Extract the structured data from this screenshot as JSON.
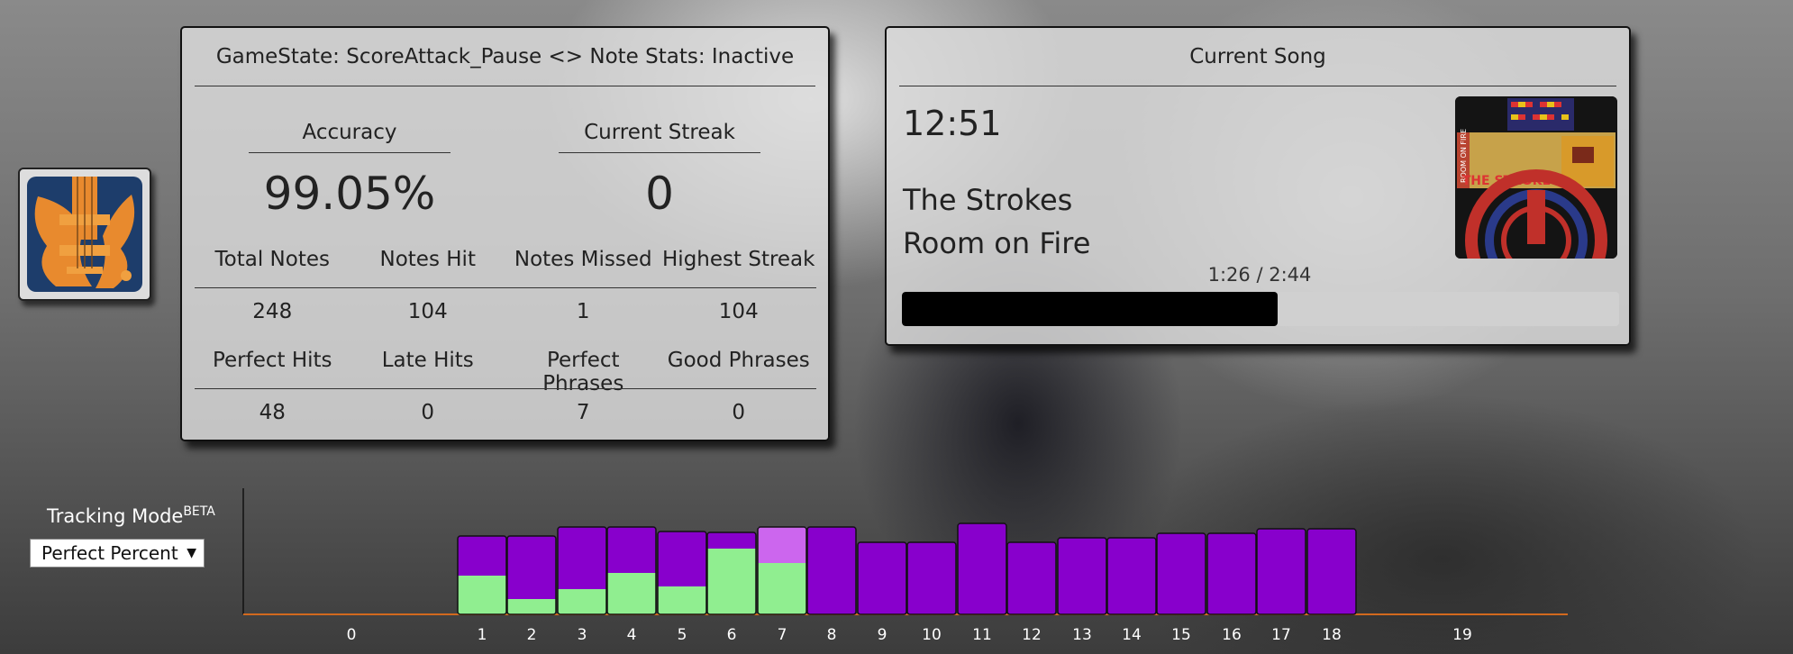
{
  "stats": {
    "title": "GameState: ScoreAttack_Pause <> Note Stats: Inactive",
    "accuracy_label": "Accuracy",
    "accuracy_value": "99.05%",
    "streak_label": "Current Streak",
    "streak_value": "0",
    "row1_headers": [
      "Total Notes",
      "Notes Hit",
      "Notes Missed",
      "Highest Streak"
    ],
    "row1_values": [
      "248",
      "104",
      "1",
      "104"
    ],
    "row2_headers": [
      "Perfect Hits",
      "Late Hits",
      "Perfect Phrases",
      "Good Phrases"
    ],
    "row2_values": [
      "48",
      "0",
      "7",
      "0"
    ]
  },
  "song": {
    "title": "Current Song",
    "time": "12:51",
    "artist": "The Strokes",
    "album": "Room on Fire",
    "progress_text": "1:26 / 2:44",
    "progress_fraction": 0.524,
    "album_art_text": "THE STROKES",
    "album_art_spine": "ROOM ON FIRE"
  },
  "tracking": {
    "label": "Tracking Mode",
    "badge": "BETA",
    "selected": "Perfect Percent",
    "caret": "▼"
  },
  "chart_data": {
    "type": "bar",
    "stacked": true,
    "categories": [
      "0",
      "1",
      "2",
      "3",
      "4",
      "5",
      "6",
      "7",
      "8",
      "9",
      "10",
      "11",
      "12",
      "13",
      "14",
      "15",
      "16",
      "17",
      "18",
      "19"
    ],
    "totals": [
      0,
      87,
      87,
      97,
      97,
      92,
      91,
      97,
      97,
      80,
      80,
      101,
      80,
      85,
      85,
      90,
      90,
      95,
      95,
      0
    ],
    "series": [
      {
        "color": "#90ee90",
        "values": [
          0,
          43,
          17,
          28,
          46,
          31,
          73,
          57,
          0,
          0,
          0,
          0,
          0,
          0,
          0,
          0,
          0,
          0,
          0,
          0
        ]
      },
      {
        "color": "#cc66ee",
        "values": [
          0,
          0,
          0,
          0,
          0,
          0,
          0,
          40,
          0,
          0,
          0,
          0,
          0,
          0,
          0,
          0,
          0,
          0,
          0,
          0
        ]
      },
      {
        "color": "#8800cc",
        "values": [
          0,
          44,
          70,
          69,
          51,
          61,
          18,
          0,
          97,
          80,
          80,
          101,
          80,
          85,
          85,
          90,
          90,
          95,
          95,
          0
        ]
      }
    ],
    "ylim": [
      0,
      140
    ],
    "axis_color": "#d2691e",
    "grid": false
  }
}
